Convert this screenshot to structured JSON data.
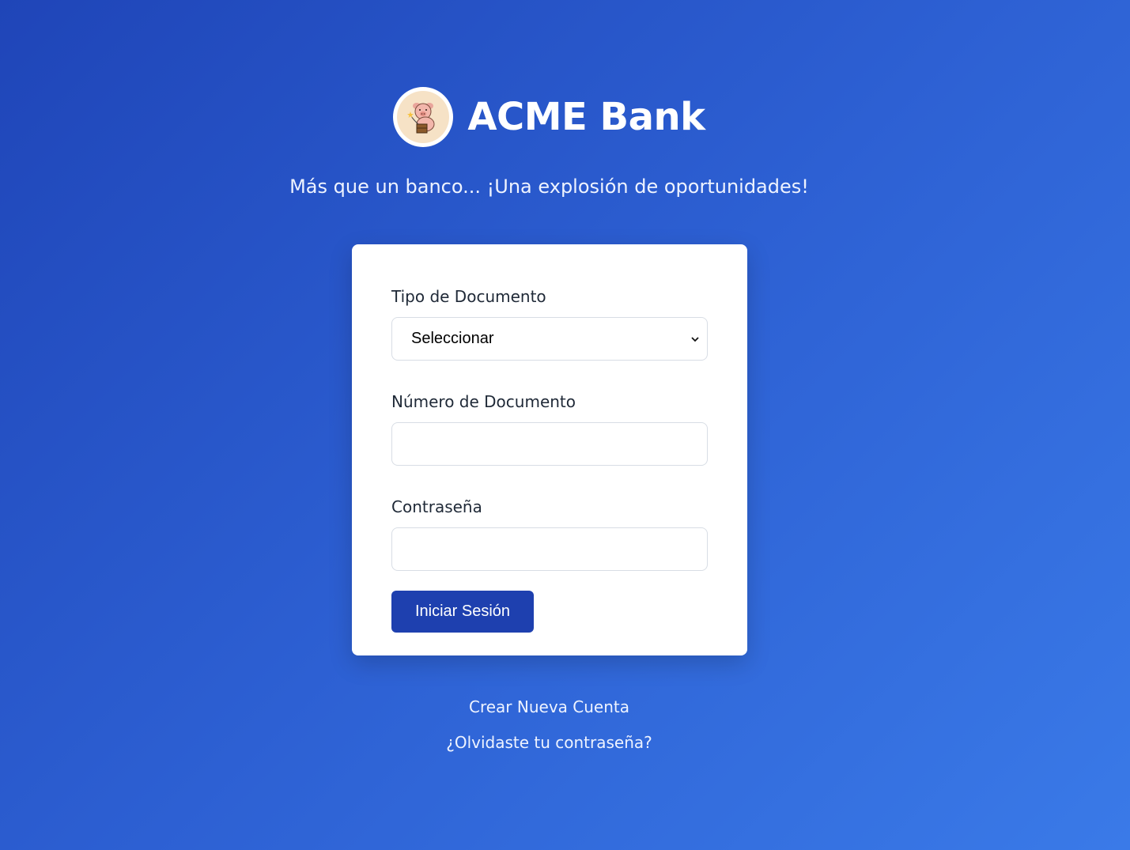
{
  "brand": {
    "title": "ACME Bank",
    "logo_icon": "pig-with-dynamite-logo",
    "tagline": "Más que un banco... ¡Una explosión de oportunidades!"
  },
  "form": {
    "doc_type_label": "Tipo de Documento",
    "doc_type_selected": "Seleccionar",
    "doc_number_label": "Número de Documento",
    "doc_number_value": "",
    "password_label": "Contraseña",
    "password_value": "",
    "submit_label": "Iniciar Sesión"
  },
  "links": {
    "create_account": "Crear Nueva Cuenta",
    "forgot_password": "¿Olvidaste tu contraseña?"
  },
  "colors": {
    "background_start": "#1f45b8",
    "background_end": "#3a7ae8",
    "button": "#1e40af",
    "card": "#ffffff"
  }
}
